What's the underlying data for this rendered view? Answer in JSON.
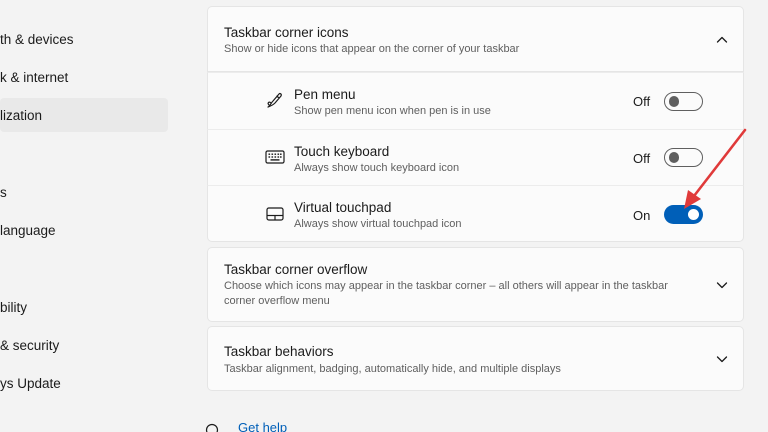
{
  "sidebar": {
    "items": [
      {
        "label": "th & devices"
      },
      {
        "label": "k & internet"
      },
      {
        "label": "lization"
      },
      {
        "label": "s"
      },
      {
        "label": "language"
      },
      {
        "label": "bility"
      },
      {
        "label": "& security"
      },
      {
        "label": "ys Update"
      }
    ]
  },
  "taskbar_corner_icons": {
    "title": "Taskbar corner icons",
    "description": "Show or hide icons that appear on the corner of your taskbar",
    "items": [
      {
        "title": "Pen menu",
        "description": "Show pen menu icon when pen is in use",
        "state": "Off",
        "on": false,
        "icon": "pen-icon"
      },
      {
        "title": "Touch keyboard",
        "description": "Always show touch keyboard icon",
        "state": "Off",
        "on": false,
        "icon": "keyboard-icon"
      },
      {
        "title": "Virtual touchpad",
        "description": "Always show virtual touchpad icon",
        "state": "On",
        "on": true,
        "icon": "touchpad-icon"
      }
    ]
  },
  "taskbar_corner_overflow": {
    "title": "Taskbar corner overflow",
    "description_line1": "Choose which icons may appear in the taskbar corner – all others will appear in the taskbar",
    "description_line2": "corner overflow menu"
  },
  "taskbar_behaviors": {
    "title": "Taskbar behaviors",
    "description": "Taskbar alignment, badging, automatically hide, and multiple displays"
  },
  "help": {
    "label": "Get help"
  },
  "colors": {
    "accent": "#005fb8",
    "annotation_arrow": "#e03a3a"
  }
}
